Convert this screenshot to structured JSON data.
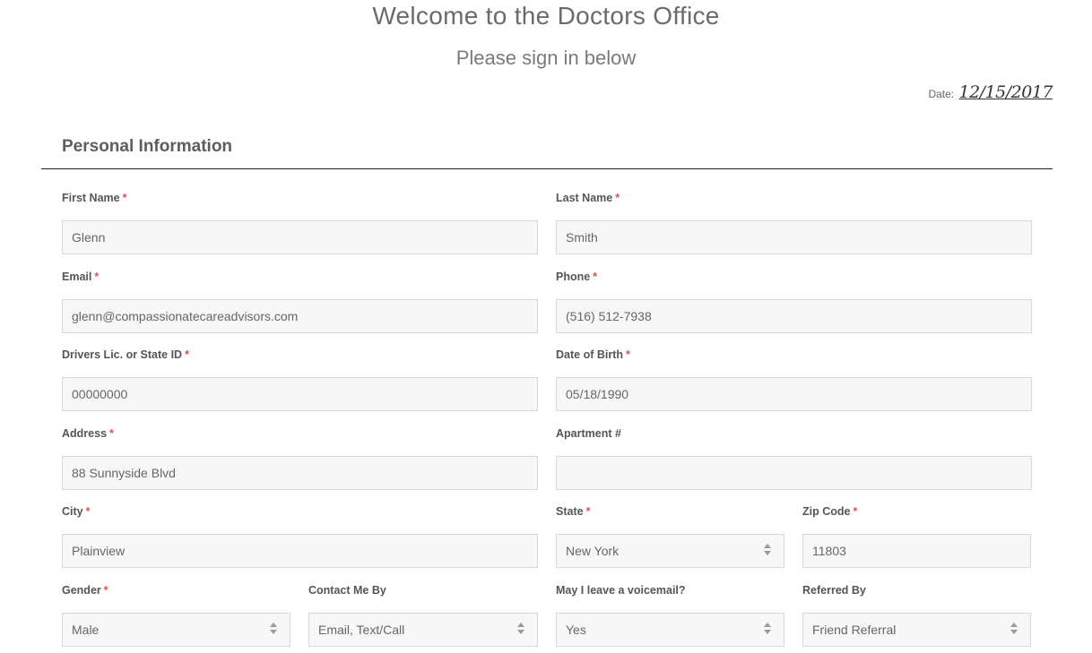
{
  "header": {
    "title": "Welcome to the Doctors Office",
    "subtitle": "Please sign in below",
    "date_label": "Date:",
    "date_value": "12/15/2017"
  },
  "section": {
    "title": "Personal Information"
  },
  "required_mark": "*",
  "fields": {
    "first_name": {
      "label": "First Name",
      "value": "Glenn"
    },
    "last_name": {
      "label": "Last Name",
      "value": "Smith"
    },
    "email": {
      "label": "Email",
      "value": "glenn@compassionatecareadvisors.com"
    },
    "phone": {
      "label": "Phone",
      "value": "(516) 512-7938"
    },
    "drivers_lic": {
      "label": "Drivers Lic. or State ID",
      "value": "00000000"
    },
    "dob": {
      "label": "Date of Birth",
      "value": "05/18/1990"
    },
    "address": {
      "label": "Address",
      "value": "88 Sunnyside Blvd"
    },
    "apartment": {
      "label": "Apartment #",
      "value": ""
    },
    "city": {
      "label": "City",
      "value": "Plainview"
    },
    "state": {
      "label": "State",
      "value": "New York"
    },
    "zip": {
      "label": "Zip Code",
      "value": "11803"
    },
    "gender": {
      "label": "Gender",
      "value": "Male"
    },
    "contact": {
      "label": "Contact Me By",
      "value": "Email, Text/Call"
    },
    "voicemail": {
      "label": "May I leave a voicemail?",
      "value": "Yes"
    },
    "referred": {
      "label": "Referred By",
      "value": "Friend Referral"
    }
  }
}
